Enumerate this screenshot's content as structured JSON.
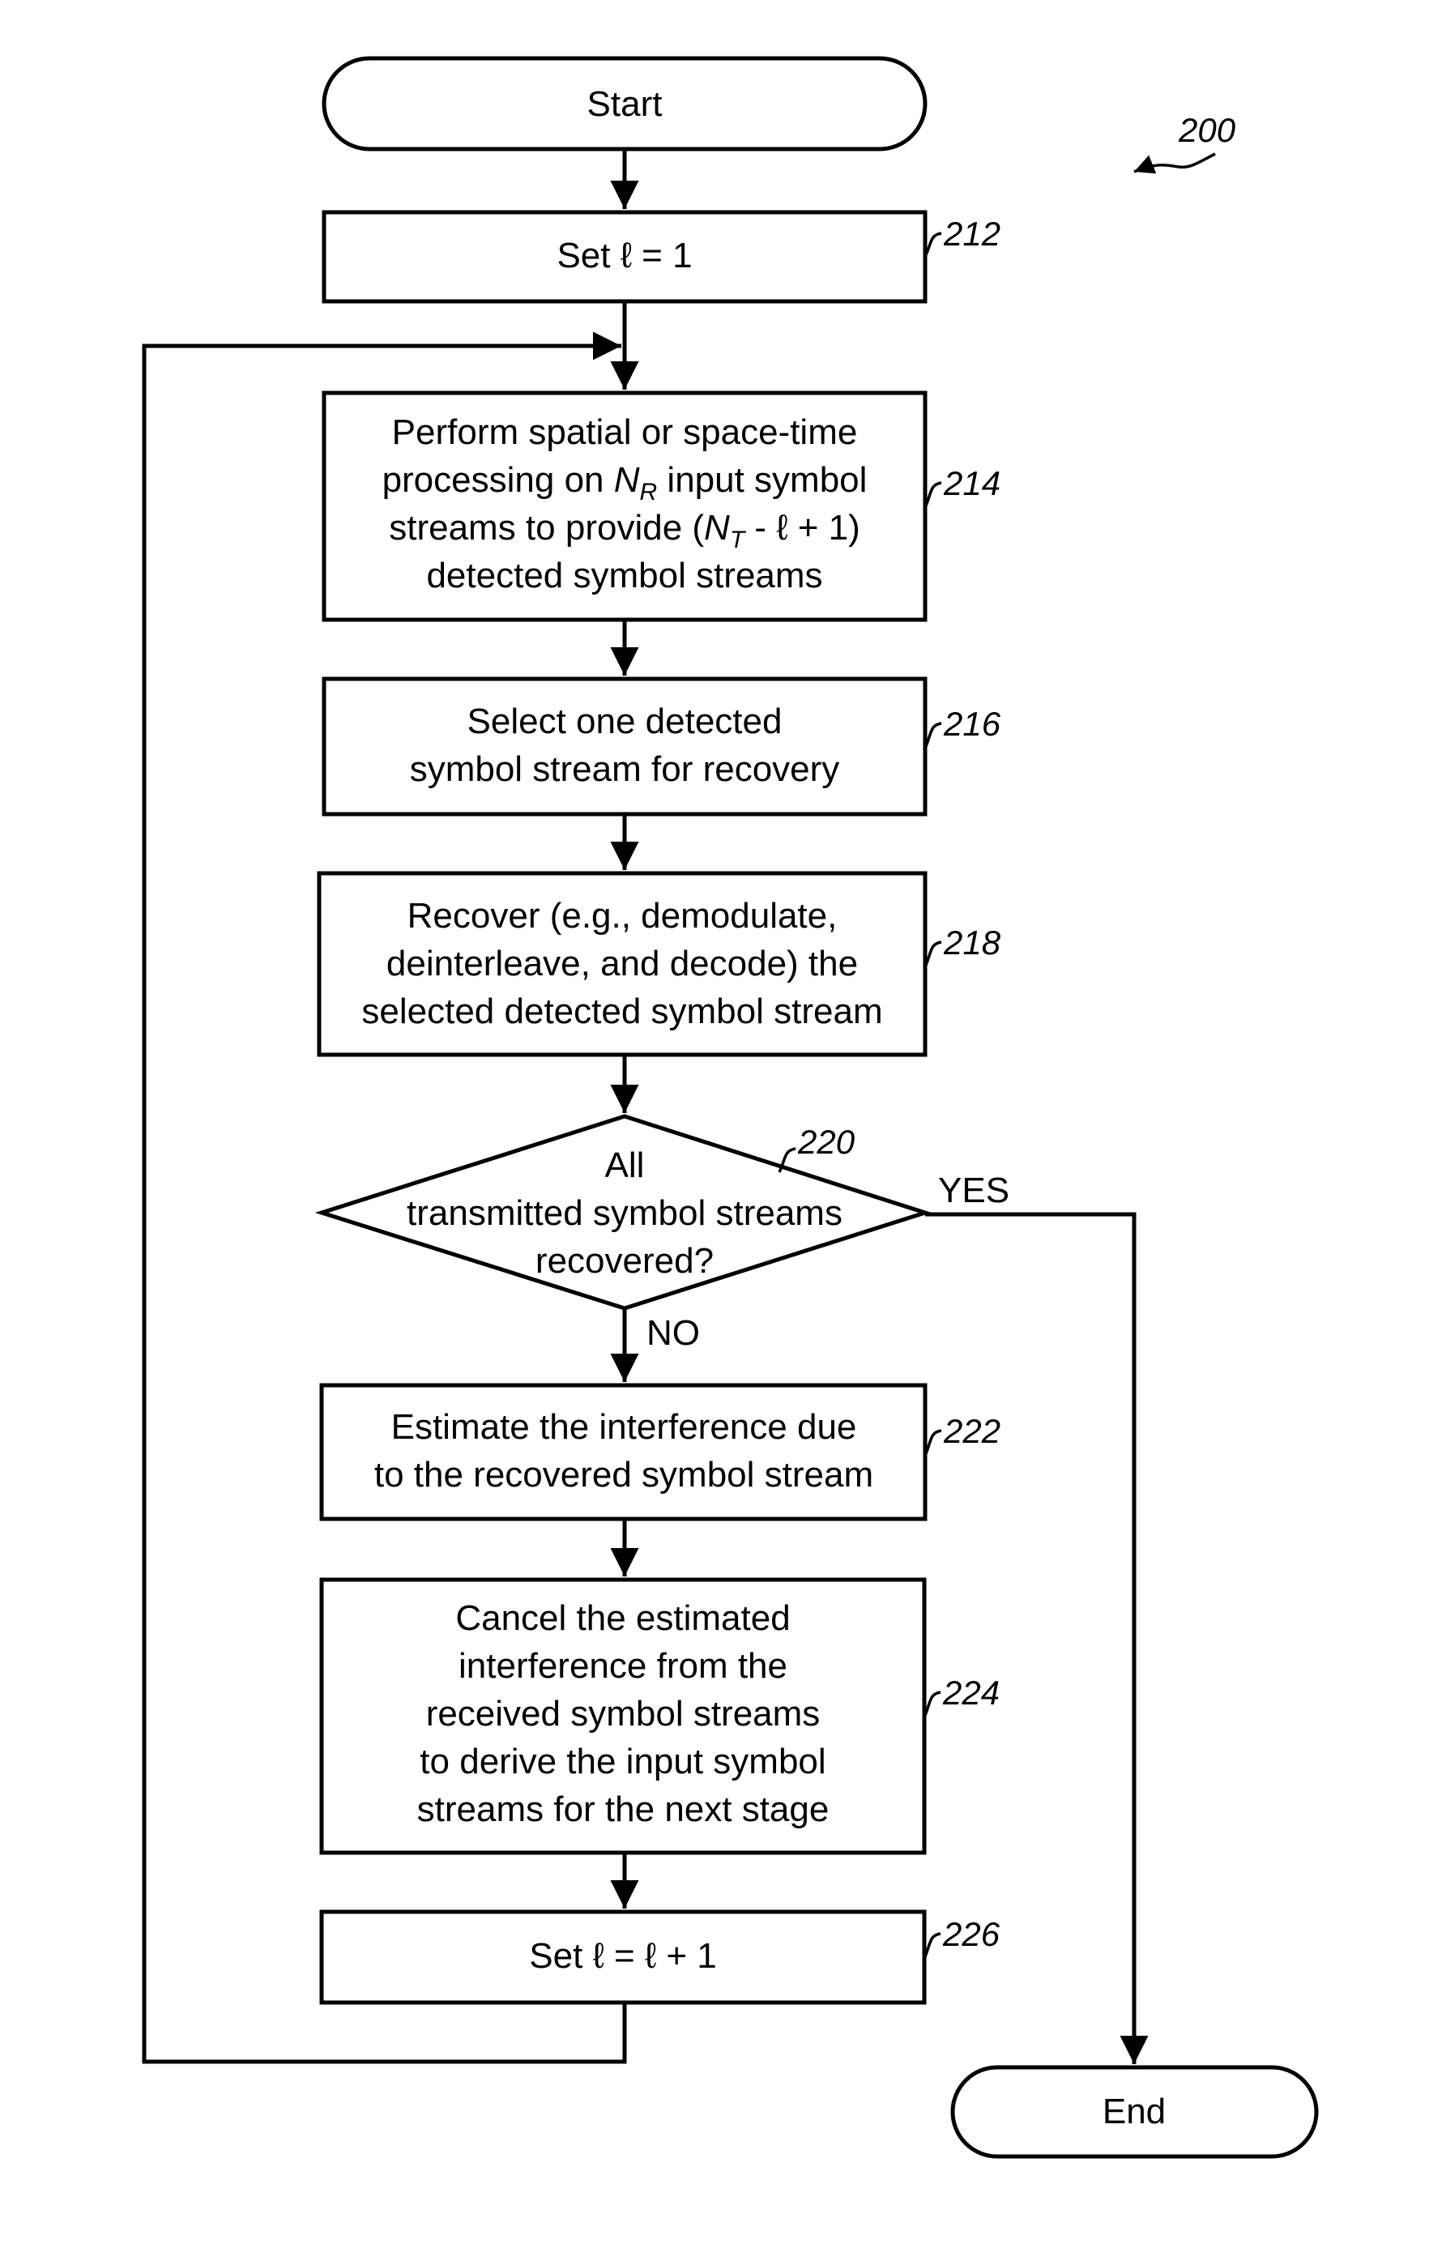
{
  "figure": {
    "reference": "200"
  },
  "nodes": [
    {
      "id": "start",
      "type": "terminal",
      "label_lines": [
        "Start"
      ]
    },
    {
      "id": "212",
      "type": "process",
      "ref": "212",
      "label_lines": [
        "Set ℓ = 1"
      ]
    },
    {
      "id": "214",
      "type": "process",
      "ref": "214",
      "label_lines": [
        "Perform spatial or space-time",
        "processing on N_R input symbol",
        "streams to provide (N_T - ℓ + 1)",
        "detected symbol streams"
      ]
    },
    {
      "id": "216",
      "type": "process",
      "ref": "216",
      "label_lines": [
        "Select one detected",
        "symbol stream for recovery"
      ]
    },
    {
      "id": "218",
      "type": "process",
      "ref": "218",
      "label_lines": [
        "Recover (e.g., demodulate,",
        "deinterleave, and decode) the",
        "selected detected symbol stream"
      ]
    },
    {
      "id": "220",
      "type": "decision",
      "ref": "220",
      "label_lines": [
        "All",
        "transmitted symbol streams",
        "recovered?"
      ]
    },
    {
      "id": "222",
      "type": "process",
      "ref": "222",
      "label_lines": [
        "Estimate the interference due",
        "to the recovered symbol stream"
      ]
    },
    {
      "id": "224",
      "type": "process",
      "ref": "224",
      "label_lines": [
        "Cancel the estimated",
        "interference from the",
        "received symbol streams",
        "to derive the input symbol",
        "streams for the next stage"
      ]
    },
    {
      "id": "226",
      "type": "process",
      "ref": "226",
      "label_lines": [
        "Set ℓ = ℓ + 1"
      ]
    },
    {
      "id": "end",
      "type": "terminal",
      "label_lines": [
        "End"
      ]
    }
  ],
  "edges": [
    {
      "from": "start",
      "to": "212",
      "label": ""
    },
    {
      "from": "212",
      "to": "214",
      "label": ""
    },
    {
      "from": "214",
      "to": "216",
      "label": ""
    },
    {
      "from": "216",
      "to": "218",
      "label": ""
    },
    {
      "from": "218",
      "to": "220",
      "label": ""
    },
    {
      "from": "220",
      "to": "end",
      "label": "YES"
    },
    {
      "from": "220",
      "to": "222",
      "label": "NO"
    },
    {
      "from": "222",
      "to": "224",
      "label": ""
    },
    {
      "from": "224",
      "to": "226",
      "label": ""
    },
    {
      "from": "226",
      "to": "214",
      "label": ""
    }
  ],
  "labels": {
    "start": "Start",
    "end": "End",
    "yes": "YES",
    "no": "NO",
    "n212_l1": "Set ℓ = 1",
    "n214_l1": "Perform spatial or space-time",
    "n214_l2a": "processing on ",
    "n214_l2_var": "N",
    "n214_l2_sub": "R",
    "n214_l2b": " input symbol",
    "n214_l3a": "streams to provide (",
    "n214_l3_var": "N",
    "n214_l3_sub": "T",
    "n214_l3b": " - ℓ + 1)",
    "n214_l4": "detected symbol streams",
    "n216_l1": "Select one detected",
    "n216_l2": "symbol stream for recovery",
    "n218_l1": "Recover (e.g., demodulate,",
    "n218_l2": "deinterleave, and decode) the",
    "n218_l3": "selected detected symbol stream",
    "n220_l1": "All",
    "n220_l2": "transmitted symbol streams",
    "n220_l3": "recovered?",
    "n222_l1": "Estimate the interference due",
    "n222_l2": "to the recovered symbol stream",
    "n224_l1": "Cancel the estimated",
    "n224_l2": "interference from the",
    "n224_l3": "received symbol streams",
    "n224_l4": "to derive the input symbol",
    "n224_l5": "streams for the next stage",
    "n226_l1": "Set ℓ = ℓ + 1"
  },
  "refs": {
    "fig": "200",
    "r212": "212",
    "r214": "214",
    "r216": "216",
    "r218": "218",
    "r220": "220",
    "r222": "222",
    "r224": "224",
    "r226": "226"
  }
}
